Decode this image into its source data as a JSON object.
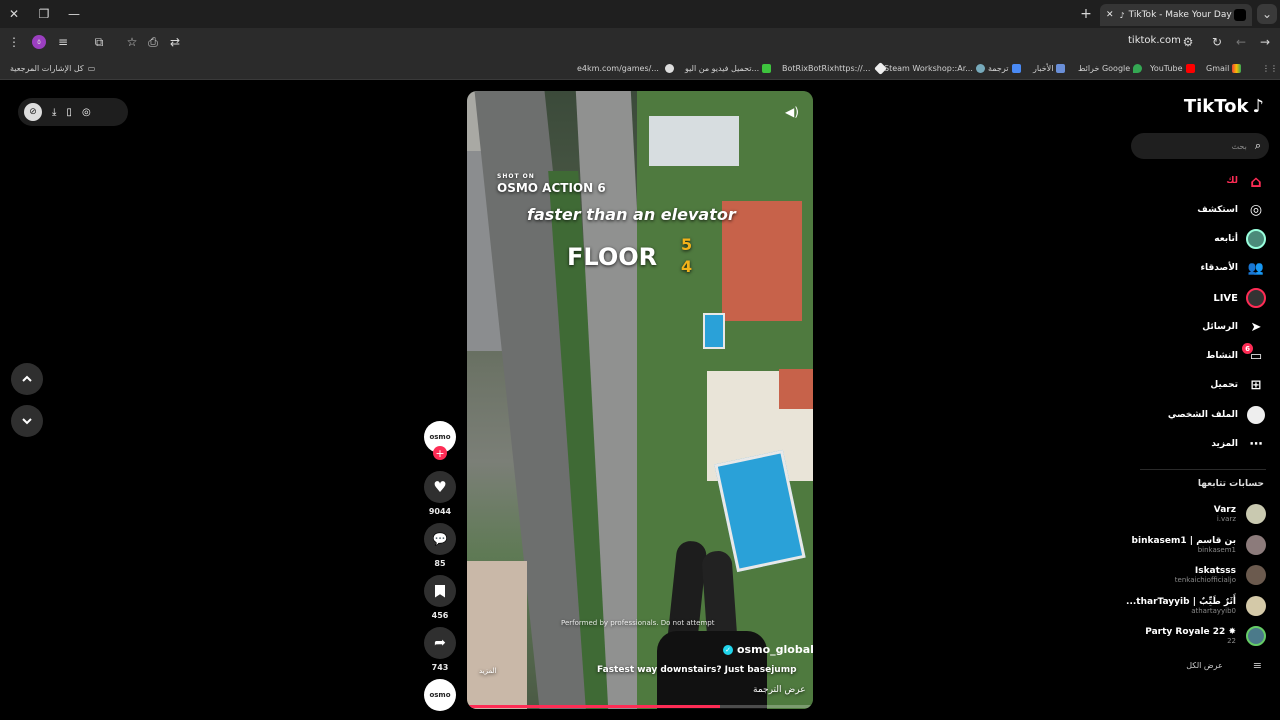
{
  "browser": {
    "tab_title": "TikTok - Make Your Day",
    "url": "tiktok.com",
    "bookmarks": [
      "Gmail",
      "YouTube",
      "خرائط Google",
      "الأخبار",
      "ترجمة",
      "Steam Workshop::Ar...",
      "BotRixBotRixhttps://...",
      "تحميل فيديو من اليو...",
      "e4km.com/games/..."
    ],
    "all_bookmarks_label": "كل الإشارات المرجعية",
    "profile_initial": "٥"
  },
  "tiktok": {
    "logo_text": "TikTok",
    "search_placeholder": "بحث",
    "nav": [
      {
        "label": "لك",
        "icon": "home-icon"
      },
      {
        "label": "استكشف",
        "icon": "compass-icon"
      },
      {
        "label": "أتابعه",
        "icon": "avatar-following-icon"
      },
      {
        "label": "الأصدقاء",
        "icon": "friends-icon"
      },
      {
        "label": "LIVE",
        "icon": "live-icon"
      },
      {
        "label": "الرسائل",
        "icon": "send-icon"
      },
      {
        "label": "النشاط",
        "icon": "activity-icon"
      },
      {
        "label": "تحميل",
        "icon": "upload-icon"
      },
      {
        "label": "الملف الشخصي",
        "icon": "profile-icon"
      },
      {
        "label": "المزيد",
        "icon": "more-icon"
      }
    ],
    "activity_badge": "6",
    "following_title": "حسابات تتابعها",
    "following": [
      {
        "name": "Varz",
        "handle": "i.varz",
        "color": "#c9c9b0"
      },
      {
        "name": "binkasem1 | بن قاسم",
        "handle": "binkasem1",
        "color": "#8c7b7b"
      },
      {
        "name": "Iskatsss",
        "handle": "tenkaichiofficialjo",
        "color": "#6b5a4e"
      },
      {
        "name": "...tharTayyib | أَثَرٌ طَيِّبٌ",
        "handle": "athartayyib0",
        "color": "#d4c9a8"
      },
      {
        "name": "Party Royale 22 ✸",
        "handle": "22",
        "color": "#4b7a8a"
      }
    ],
    "show_all": "عرض الكل"
  },
  "video": {
    "top_text": "SHOT ON",
    "camera_text": "OSMO ACTION 6",
    "caption_line1": "faster than an elevator",
    "caption_floor": "FLOOR",
    "floor_numbers": [
      "5",
      "4"
    ],
    "disclaimer": "Performed by professionals. Do not attempt",
    "author": "osmo_global",
    "description": "Fastest way downstairs? Just basejump",
    "more": "المزيد",
    "translate": "عرض الترجمة",
    "progress": 0.73
  },
  "actions": {
    "likes": "9044",
    "comments": "85",
    "saves": "456",
    "shares": "743",
    "avatar_label": "osmo"
  },
  "colors": {
    "accent": "#fe2c55",
    "bg": "#000000"
  }
}
